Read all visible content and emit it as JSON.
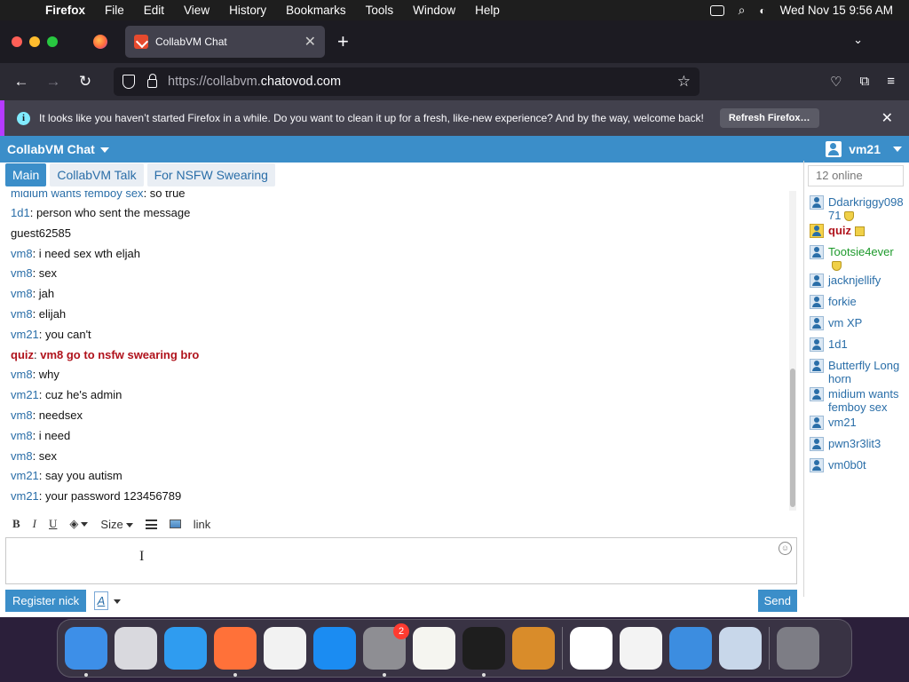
{
  "menubar": {
    "items": [
      "Firefox",
      "File",
      "Edit",
      "View",
      "History",
      "Bookmarks",
      "Tools",
      "Window",
      "Help"
    ],
    "datetime": "Wed Nov 15  9:56 AM"
  },
  "browser": {
    "tab_title": "CollabVM Chat",
    "url_host_prefix": "https://collabvm.",
    "url_host_main": "chatovod.com",
    "infobar_text": "It looks like you haven’t started Firefox in a while. Do you want to clean it up for a fresh, like-new experience? And by the way, welcome back!",
    "infobar_button": "Refresh Firefox…"
  },
  "chat": {
    "title": "CollabVM Chat",
    "current_user": "vm21",
    "tabs": [
      {
        "label": "Main",
        "active": true
      },
      {
        "label": "CollabVM Talk",
        "active": false
      },
      {
        "label": "For NSFW Swearing",
        "active": false
      }
    ],
    "messages": [
      {
        "nick": "midium wants femboy sex",
        "text": "so true",
        "role": "user"
      },
      {
        "nick": "1d1",
        "text": "person who sent the message",
        "role": "user"
      },
      {
        "nick": "",
        "text": "guest62585",
        "role": "plain"
      },
      {
        "nick": "vm8",
        "text": "i need sex wth eljah",
        "role": "user"
      },
      {
        "nick": "vm8",
        "text": "sex",
        "role": "user"
      },
      {
        "nick": "vm8",
        "text": "jah",
        "role": "user"
      },
      {
        "nick": "vm8",
        "text": "elijah",
        "role": "user"
      },
      {
        "nick": "vm21",
        "text": "you can't",
        "role": "user"
      },
      {
        "nick": "quiz",
        "text": "vm8 go to nsfw swearing bro",
        "role": "admin"
      },
      {
        "nick": "vm8",
        "text": "why",
        "role": "user"
      },
      {
        "nick": "vm21",
        "text": "cuz he's admin",
        "role": "user"
      },
      {
        "nick": "vm8",
        "text": "needsex",
        "role": "user"
      },
      {
        "nick": "vm8",
        "text": "i need",
        "role": "user"
      },
      {
        "nick": "vm8",
        "text": "sex",
        "role": "user"
      },
      {
        "nick": "vm21",
        "text": "say you autism",
        "role": "user"
      },
      {
        "nick": "vm21",
        "text": "your password 123456789",
        "role": "user"
      }
    ],
    "toolbar": {
      "bold": "B",
      "italic": "I",
      "underline": "U",
      "size": "Size",
      "link": "link"
    },
    "register_label": "Register nick",
    "font_label": "A",
    "send_label": "Send",
    "online_label": "12 online",
    "users": [
      {
        "name": "Ddarkriggy09871",
        "role": "user",
        "badge": "shield"
      },
      {
        "name": "quiz",
        "role": "admin",
        "badge": "crown"
      },
      {
        "name": "Tootsie4ever",
        "role": "mod",
        "badge": "shield"
      },
      {
        "name": "jacknjellify",
        "role": "user",
        "badge": ""
      },
      {
        "name": "forkie",
        "role": "user",
        "badge": ""
      },
      {
        "name": "vm XP",
        "role": "user",
        "badge": ""
      },
      {
        "name": "1d1",
        "role": "user",
        "badge": ""
      },
      {
        "name": "Butterfly Longhorn",
        "role": "user",
        "badge": ""
      },
      {
        "name": "midium wants femboy sex",
        "role": "user",
        "badge": ""
      },
      {
        "name": "vm21",
        "role": "user",
        "badge": ""
      },
      {
        "name": "pwn3r3lit3",
        "role": "user",
        "badge": ""
      },
      {
        "name": "vm0b0t",
        "role": "user",
        "badge": ""
      }
    ]
  },
  "dock": {
    "apps": [
      {
        "name": "finder",
        "color": "#3d8fe8",
        "running": true
      },
      {
        "name": "launchpad",
        "color": "#d9d9de",
        "running": false
      },
      {
        "name": "safari",
        "color": "#2f9cf0",
        "running": false
      },
      {
        "name": "firefox",
        "color": "#ff7139",
        "running": true
      },
      {
        "name": "chrome",
        "color": "#f2f2f2",
        "running": false
      },
      {
        "name": "app-store",
        "color": "#1b8cf2",
        "running": false
      },
      {
        "name": "system-settings",
        "color": "#8e8e93",
        "running": true,
        "badge": "2"
      },
      {
        "name": "textedit",
        "color": "#f5f5f0",
        "running": false
      },
      {
        "name": "terminal",
        "color": "#1e1e1e",
        "running": true
      },
      {
        "name": "garageband",
        "color": "#d98c2a",
        "running": false
      },
      {
        "name": "vscode",
        "color": "#ffffff",
        "running": false
      },
      {
        "name": "visual-studio",
        "color": "#f3f3f3",
        "running": false
      },
      {
        "name": "weather",
        "color": "#3c8de0",
        "running": false
      },
      {
        "name": "virtualbox",
        "color": "#c8d7ea",
        "running": false
      },
      {
        "name": "trash",
        "color": "#7d7d85",
        "running": false
      }
    ]
  },
  "colors": {
    "accent": "#3b8ec9",
    "nick": "#2a6ea8",
    "admin": "#b0131c",
    "mod": "#1e9a2c"
  }
}
